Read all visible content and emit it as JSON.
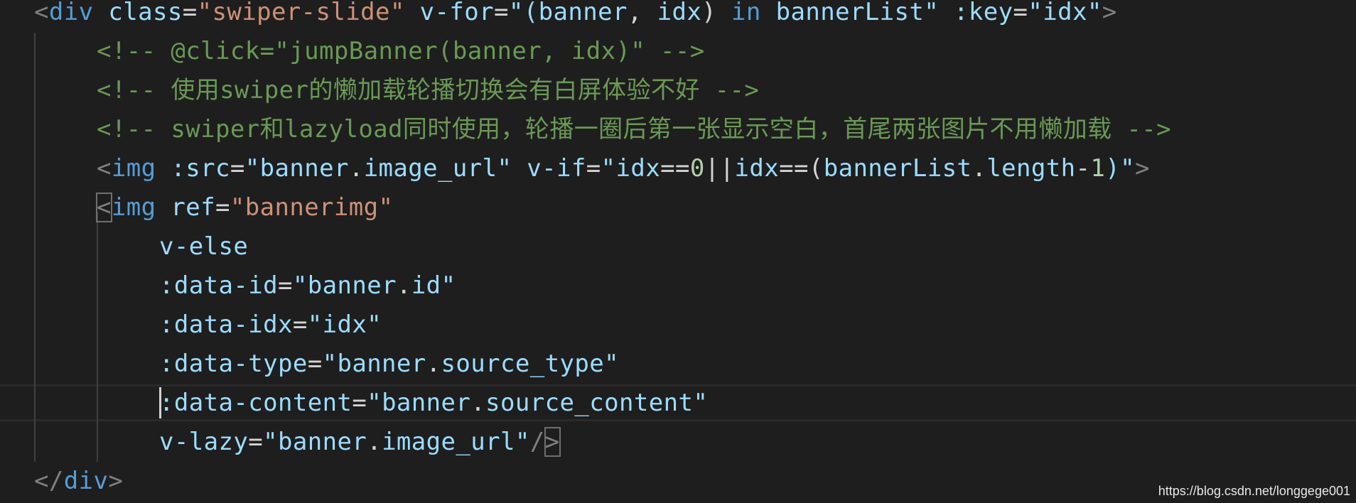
{
  "editor": {
    "lines": [
      {
        "tokens": [
          {
            "t": "<",
            "c": "c-punct"
          },
          {
            "t": "div",
            "c": "c-tag"
          },
          {
            "t": " ",
            "c": "c-text"
          },
          {
            "t": "class",
            "c": "c-attr"
          },
          {
            "t": "=",
            "c": "c-text"
          },
          {
            "t": "\"swiper-slide\"",
            "c": "c-str"
          },
          {
            "t": " ",
            "c": "c-text"
          },
          {
            "t": "v-for",
            "c": "c-attr"
          },
          {
            "t": "=",
            "c": "c-text"
          },
          {
            "t": "\"(",
            "c": "c-attr"
          },
          {
            "t": "banner",
            "c": "c-attr"
          },
          {
            "t": ", ",
            "c": "c-text"
          },
          {
            "t": "idx",
            "c": "c-attr"
          },
          {
            "t": ") ",
            "c": "c-text"
          },
          {
            "t": "in",
            "c": "c-kw"
          },
          {
            "t": " ",
            "c": "c-text"
          },
          {
            "t": "bannerList",
            "c": "c-attr"
          },
          {
            "t": "\"",
            "c": "c-attr"
          },
          {
            "t": " ",
            "c": "c-text"
          },
          {
            "t": ":key",
            "c": "c-attr"
          },
          {
            "t": "=",
            "c": "c-text"
          },
          {
            "t": "\"",
            "c": "c-attr"
          },
          {
            "t": "idx",
            "c": "c-attr"
          },
          {
            "t": "\"",
            "c": "c-attr"
          },
          {
            "t": ">",
            "c": "c-punct"
          }
        ]
      },
      {
        "tokens": [
          {
            "t": "<!-- @click=\"jumpBanner(banner, idx)\" -->",
            "c": "c-comment"
          }
        ]
      },
      {
        "tokens": [
          {
            "t": "<!-- 使用swiper的懒加载轮播切换会有白屏体验不好 -->",
            "c": "c-comment"
          }
        ]
      },
      {
        "tokens": [
          {
            "t": "<!-- swiper和lazyload同时使用，轮播一圈后第一张显示空白，首尾两张图片不用懒加载 -->",
            "c": "c-comment"
          }
        ]
      },
      {
        "tokens": [
          {
            "t": "<",
            "c": "c-punct"
          },
          {
            "t": "img",
            "c": "c-tag"
          },
          {
            "t": " ",
            "c": "c-text"
          },
          {
            "t": ":src",
            "c": "c-attr"
          },
          {
            "t": "=",
            "c": "c-text"
          },
          {
            "t": "\"",
            "c": "c-attr"
          },
          {
            "t": "banner",
            "c": "c-attr"
          },
          {
            "t": ".",
            "c": "c-text"
          },
          {
            "t": "image_url",
            "c": "c-attr"
          },
          {
            "t": "\"",
            "c": "c-attr"
          },
          {
            "t": " ",
            "c": "c-text"
          },
          {
            "t": "v-if",
            "c": "c-attr"
          },
          {
            "t": "=",
            "c": "c-text"
          },
          {
            "t": "\"",
            "c": "c-attr"
          },
          {
            "t": "idx",
            "c": "c-attr"
          },
          {
            "t": "==",
            "c": "c-text"
          },
          {
            "t": "0",
            "c": "c-num"
          },
          {
            "t": "||",
            "c": "c-text"
          },
          {
            "t": "idx",
            "c": "c-attr"
          },
          {
            "t": "==(",
            "c": "c-text"
          },
          {
            "t": "bannerList",
            "c": "c-attr"
          },
          {
            "t": ".",
            "c": "c-text"
          },
          {
            "t": "length",
            "c": "c-attr"
          },
          {
            "t": "-",
            "c": "c-text"
          },
          {
            "t": "1",
            "c": "c-num"
          },
          {
            "t": ")\"",
            "c": "c-attr"
          },
          {
            "t": ">",
            "c": "c-punct"
          }
        ]
      },
      {
        "tokens": [
          {
            "t": "<",
            "c": "c-punct bracket-box"
          },
          {
            "t": "img",
            "c": "c-tag"
          },
          {
            "t": " ",
            "c": "c-text"
          },
          {
            "t": "ref",
            "c": "c-attr"
          },
          {
            "t": "=",
            "c": "c-text"
          },
          {
            "t": "\"bannerimg\"",
            "c": "c-str"
          }
        ]
      },
      {
        "tokens": [
          {
            "t": "v-else",
            "c": "c-attr"
          }
        ]
      },
      {
        "tokens": [
          {
            "t": ":data-id",
            "c": "c-attr"
          },
          {
            "t": "=",
            "c": "c-text"
          },
          {
            "t": "\"",
            "c": "c-attr"
          },
          {
            "t": "banner",
            "c": "c-attr"
          },
          {
            "t": ".",
            "c": "c-text"
          },
          {
            "t": "id",
            "c": "c-attr"
          },
          {
            "t": "\"",
            "c": "c-attr"
          }
        ]
      },
      {
        "tokens": [
          {
            "t": ":data-idx",
            "c": "c-attr"
          },
          {
            "t": "=",
            "c": "c-text"
          },
          {
            "t": "\"",
            "c": "c-attr"
          },
          {
            "t": "idx",
            "c": "c-attr"
          },
          {
            "t": "\"",
            "c": "c-attr"
          }
        ]
      },
      {
        "tokens": [
          {
            "t": ":data-type",
            "c": "c-attr"
          },
          {
            "t": "=",
            "c": "c-text"
          },
          {
            "t": "\"",
            "c": "c-attr"
          },
          {
            "t": "banner",
            "c": "c-attr"
          },
          {
            "t": ".",
            "c": "c-text"
          },
          {
            "t": "source_type",
            "c": "c-attr"
          },
          {
            "t": "\"",
            "c": "c-attr"
          }
        ]
      },
      {
        "caret": true,
        "tokens": [
          {
            "t": ":data-content",
            "c": "c-attr"
          },
          {
            "t": "=",
            "c": "c-text"
          },
          {
            "t": "\"",
            "c": "c-attr"
          },
          {
            "t": "banner",
            "c": "c-attr"
          },
          {
            "t": ".",
            "c": "c-text"
          },
          {
            "t": "source_content",
            "c": "c-attr"
          },
          {
            "t": "\"",
            "c": "c-attr"
          }
        ]
      },
      {
        "tokens": [
          {
            "t": "v-lazy",
            "c": "c-attr"
          },
          {
            "t": "=",
            "c": "c-text"
          },
          {
            "t": "\"",
            "c": "c-attr"
          },
          {
            "t": "banner",
            "c": "c-attr"
          },
          {
            "t": ".",
            "c": "c-text"
          },
          {
            "t": "image_url",
            "c": "c-attr"
          },
          {
            "t": "\"",
            "c": "c-attr"
          },
          {
            "t": "/",
            "c": "c-punct"
          },
          {
            "t": ">",
            "c": "c-punct bracket-box"
          }
        ]
      },
      {
        "tokens": [
          {
            "t": "</",
            "c": "c-punct"
          },
          {
            "t": "div",
            "c": "c-tag"
          },
          {
            "t": ">",
            "c": "c-punct"
          }
        ]
      }
    ]
  },
  "watermark": "https://blog.csdn.net/longgege001"
}
